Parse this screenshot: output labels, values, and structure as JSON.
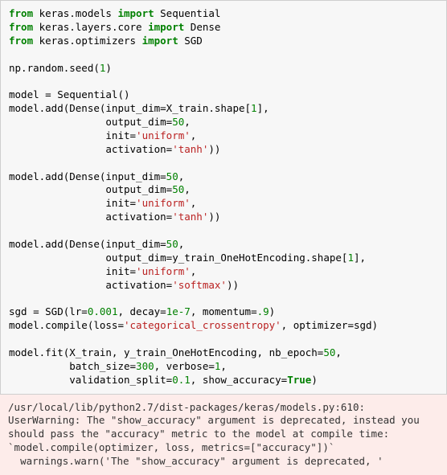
{
  "code": {
    "from1": "from",
    "mod1": " keras.models ",
    "imp1": "import",
    "name1": " Sequential",
    "from2": "from",
    "mod2": " keras.layers.core ",
    "imp2": "import",
    "name2": " Dense",
    "from3": "from",
    "mod3": " keras.optimizers ",
    "imp3": "import",
    "name3": " SGD",
    "seed_a": "np.random.seed(",
    "seed_n": "1",
    "seed_b": ")",
    "m0": "model = Sequential()",
    "l1a": "model.add(Dense(input_dim=X_train.shape[",
    "l1a_n": "1",
    "l1a_b": "],",
    "l1b": "                output_dim=",
    "l1b_n": "50",
    "l1b_e": ",",
    "l1c": "                init=",
    "l1c_s": "'uniform'",
    "l1c_e": ",",
    "l1d": "                activation=",
    "l1d_s": "'tanh'",
    "l1d_e": "))",
    "l2a": "model.add(Dense(input_dim=",
    "l2a_n": "50",
    "l2a_e": ",",
    "l2b": "                output_dim=",
    "l2b_n": "50",
    "l2b_e": ",",
    "l2c": "                init=",
    "l2c_s": "'uniform'",
    "l2c_e": ",",
    "l2d": "                activation=",
    "l2d_s": "'tanh'",
    "l2d_e": "))",
    "l3a": "model.add(Dense(input_dim=",
    "l3a_n": "50",
    "l3a_e": ",",
    "l3b": "                output_dim=y_train_OneHotEncoding.shape[",
    "l3b_n": "1",
    "l3b_e": "],",
    "l3c": "                init=",
    "l3c_s": "'uniform'",
    "l3c_e": ",",
    "l3d": "                activation=",
    "l3d_s": "'softmax'",
    "l3d_e": "))",
    "sgd_a": "sgd = SGD(lr=",
    "sgd_lr": "0.001",
    "sgd_b": ", decay=",
    "sgd_dec": "1e-7",
    "sgd_c": ", momentum=",
    "sgd_mom": ".9",
    "sgd_d": ")",
    "comp_a": "model.compile(loss=",
    "comp_s": "'categorical_crossentropy'",
    "comp_b": ", optimizer=sgd)",
    "fit_a": "model.fit(X_train, y_train_OneHotEncoding, nb_epoch=",
    "fit_ep": "50",
    "fit_b": ",",
    "fit_c": "          batch_size=",
    "fit_bs": "300",
    "fit_d": ", verbose=",
    "fit_vb": "1",
    "fit_e": ",",
    "fit_f": "          validation_split=",
    "fit_vs": "0.1",
    "fit_g": ", show_accuracy=",
    "fit_true": "True",
    "fit_h": ")"
  },
  "output": {
    "text": "/usr/local/lib/python2.7/dist-packages/keras/models.py:610: UserWarning: The \"show_accuracy\" argument is deprecated, instead you should pass the \"accuracy\" metric to the model at compile time:\n`model.compile(optimizer, loss, metrics=[\"accuracy\"])`\n  warnings.warn('The \"show_accuracy\" argument is deprecated, '"
  }
}
